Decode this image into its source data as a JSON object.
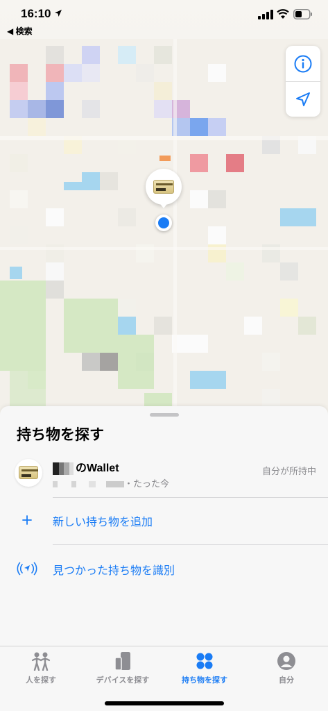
{
  "status_bar": {
    "time": "16:10",
    "back_label": "◀ 検索"
  },
  "map": {
    "controls": [
      "info-icon",
      "location-arrow-icon"
    ]
  },
  "sheet": {
    "title": "持ち物を探す",
    "item": {
      "name": "のWallet",
      "subtitle": "・たった今",
      "status": "自分が所持中"
    },
    "actions": [
      {
        "label": "新しい持ち物を追加",
        "icon": "plus-icon"
      },
      {
        "label": "見つかった持ち物を識別",
        "icon": "identify-broadcast-icon"
      }
    ]
  },
  "tabs": [
    {
      "label": "人を探す",
      "icon": "people-icon",
      "active": false
    },
    {
      "label": "デバイスを探す",
      "icon": "devices-icon",
      "active": false
    },
    {
      "label": "持ち物を探す",
      "icon": "items-icon",
      "active": true
    },
    {
      "label": "自分",
      "icon": "me-icon",
      "active": false
    }
  ],
  "colors": {
    "accent": "#1a7cf5",
    "inactive_tab": "#8e8e93",
    "sheet_bg": "#f7f7f7"
  }
}
